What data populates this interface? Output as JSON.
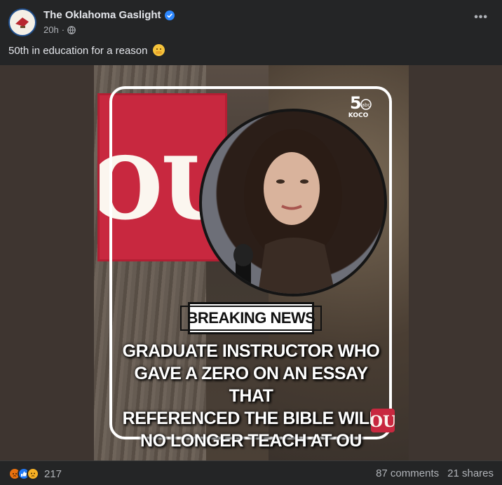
{
  "post": {
    "author": "The Oklahoma Gaslight",
    "time": "20h",
    "more": "•••",
    "caption": "50th in education for a reason"
  },
  "media": {
    "channel_number": "5",
    "channel_network": "abc",
    "channel_name": "KOCO",
    "banner_text": "OU",
    "badge_text": "BREAKING NEWS",
    "headline_lines": [
      "GRADUATE INSTRUCTOR WHO",
      "GAVE A ZERO ON AN ESSAY THAT",
      "REFERENCED THE BIBLE WILL",
      "NO LONGER TEACH AT OU"
    ]
  },
  "footer": {
    "reaction_count": "217",
    "comments": "87 comments",
    "shares": "21 shares",
    "reaction_icons": [
      "angry-icon",
      "like-icon",
      "sad-icon"
    ]
  },
  "colors": {
    "background": "#242526",
    "ou_crimson": "#c8283f",
    "verified_blue": "#2d88ff"
  }
}
